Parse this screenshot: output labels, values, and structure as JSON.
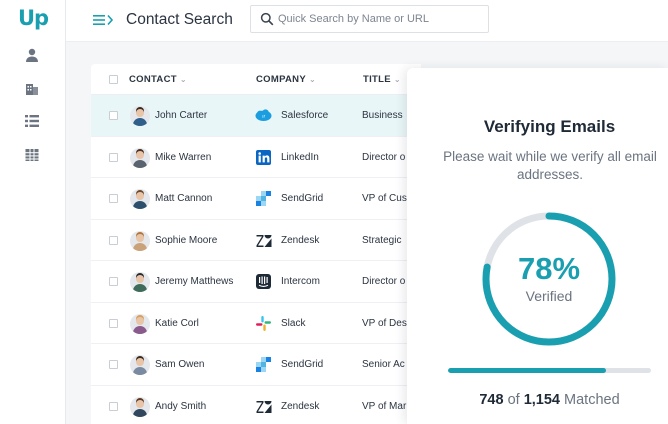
{
  "app": {
    "logo": "Up"
  },
  "header": {
    "title": "Contact Search",
    "search_placeholder": "Quick Search by Name or URL",
    "search_value": ""
  },
  "sidebar": {
    "items": [
      {
        "icon": "user-icon"
      },
      {
        "icon": "building-icon"
      },
      {
        "icon": "list-icon"
      },
      {
        "icon": "grid-icon"
      }
    ]
  },
  "table": {
    "columns": [
      "CONTACT",
      "COMPANY",
      "TITLE"
    ],
    "rows": [
      {
        "name": "John Carter",
        "company": "Salesforce",
        "title": "Business",
        "company_icon": "salesforce-logo",
        "highlight": true
      },
      {
        "name": "Mike Warren",
        "company": "LinkedIn",
        "title": "Director o",
        "company_icon": "linkedin-logo"
      },
      {
        "name": "Matt Cannon",
        "company": "SendGrid",
        "title": "VP of Cus",
        "company_icon": "sendgrid-logo"
      },
      {
        "name": "Sophie Moore",
        "company": "Zendesk",
        "title": "Strategic",
        "company_icon": "zendesk-logo"
      },
      {
        "name": "Jeremy Matthews",
        "company": "Intercom",
        "title": "Director o",
        "company_icon": "intercom-logo"
      },
      {
        "name": "Katie Corl",
        "company": "Slack",
        "title": "VP of Des",
        "company_icon": "slack-logo"
      },
      {
        "name": "Sam Owen",
        "company": "SendGrid",
        "title": "Senior Ac",
        "company_icon": "sendgrid-logo"
      },
      {
        "name": "Andy Smith",
        "company": "Zendesk",
        "title": "VP of Mar",
        "company_icon": "zendesk-logo"
      }
    ]
  },
  "verify": {
    "title": "Verifying Emails",
    "subtitle": "Please wait while we verify all email addresses.",
    "percent_label": "78%",
    "percent": 78,
    "verified_label": "Verified",
    "matched": "748",
    "of_label": "of",
    "total": "1,154",
    "matched_label": "Matched",
    "progress": 0.78
  },
  "colors": {
    "accent": "#1a9fb0",
    "highlight_row": "#e9f6f8"
  }
}
